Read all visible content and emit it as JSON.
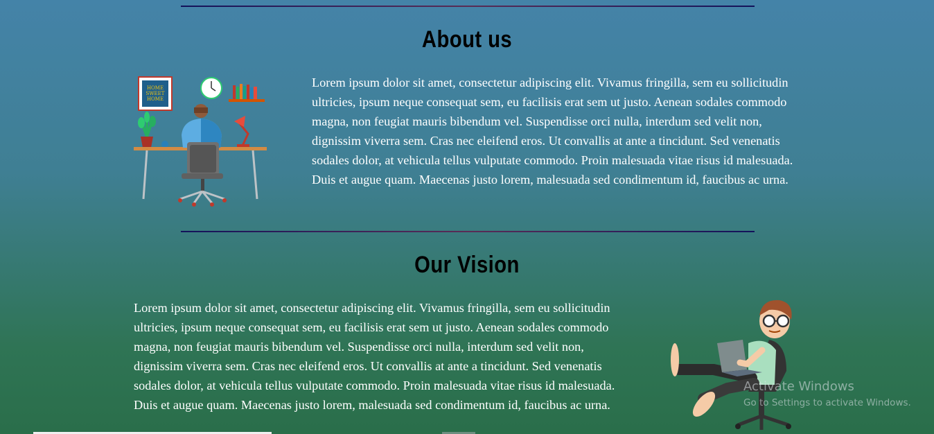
{
  "about": {
    "title": "About us",
    "text": "Lorem ipsum dolor sit amet, consectetur adipiscing elit. Vivamus fringilla, sem eu sollicitudin ultricies, ipsum neque consequat sem, eu facilisis erat sem ut justo. Aenean sodales commodo magna, non feugiat mauris bibendum vel. Suspendisse orci nulla, interdum sed velit non, dignissim viverra sem. Cras nec eleifend eros. Ut convallis at ante a tincidunt. Sed venenatis sodales dolor, at vehicula tellus vulputate commodo. Proin malesuada vitae risus id malesuada. Duis et augue quam. Maecenas justo lorem, malesuada sed condimentum id, faucibus ac urna.",
    "frame_text": [
      "HOME",
      "SWEET",
      "HOME"
    ]
  },
  "vision": {
    "title": "Our Vision",
    "text": "Lorem ipsum dolor sit amet, consectetur adipiscing elit. Vivamus fringilla, sem eu sollicitudin ultricies, ipsum neque consequat sem, eu facilisis erat sem ut justo. Aenean sodales commodo magna, non feugiat mauris bibendum vel. Suspendisse orci nulla, interdum sed velit non, dignissim viverra sem. Cras nec eleifend eros. Ut convallis at ante a tincidunt. Sed venenatis sodales dolor, at vehicula tellus vulputate commodo. Proin malesuada vitae risus id malesuada. Duis et augue quam. Maecenas justo lorem, malesuada sed condimentum id, faucibus ac urna."
  },
  "watermark": {
    "title": "Activate Windows",
    "subtitle": "Go to Settings to activate Windows."
  },
  "colors": {
    "background_top": "#4483a8",
    "background_bottom": "#2a6e4a",
    "divider": "#12125a",
    "heading": "#000000",
    "text": "#ffffff"
  }
}
